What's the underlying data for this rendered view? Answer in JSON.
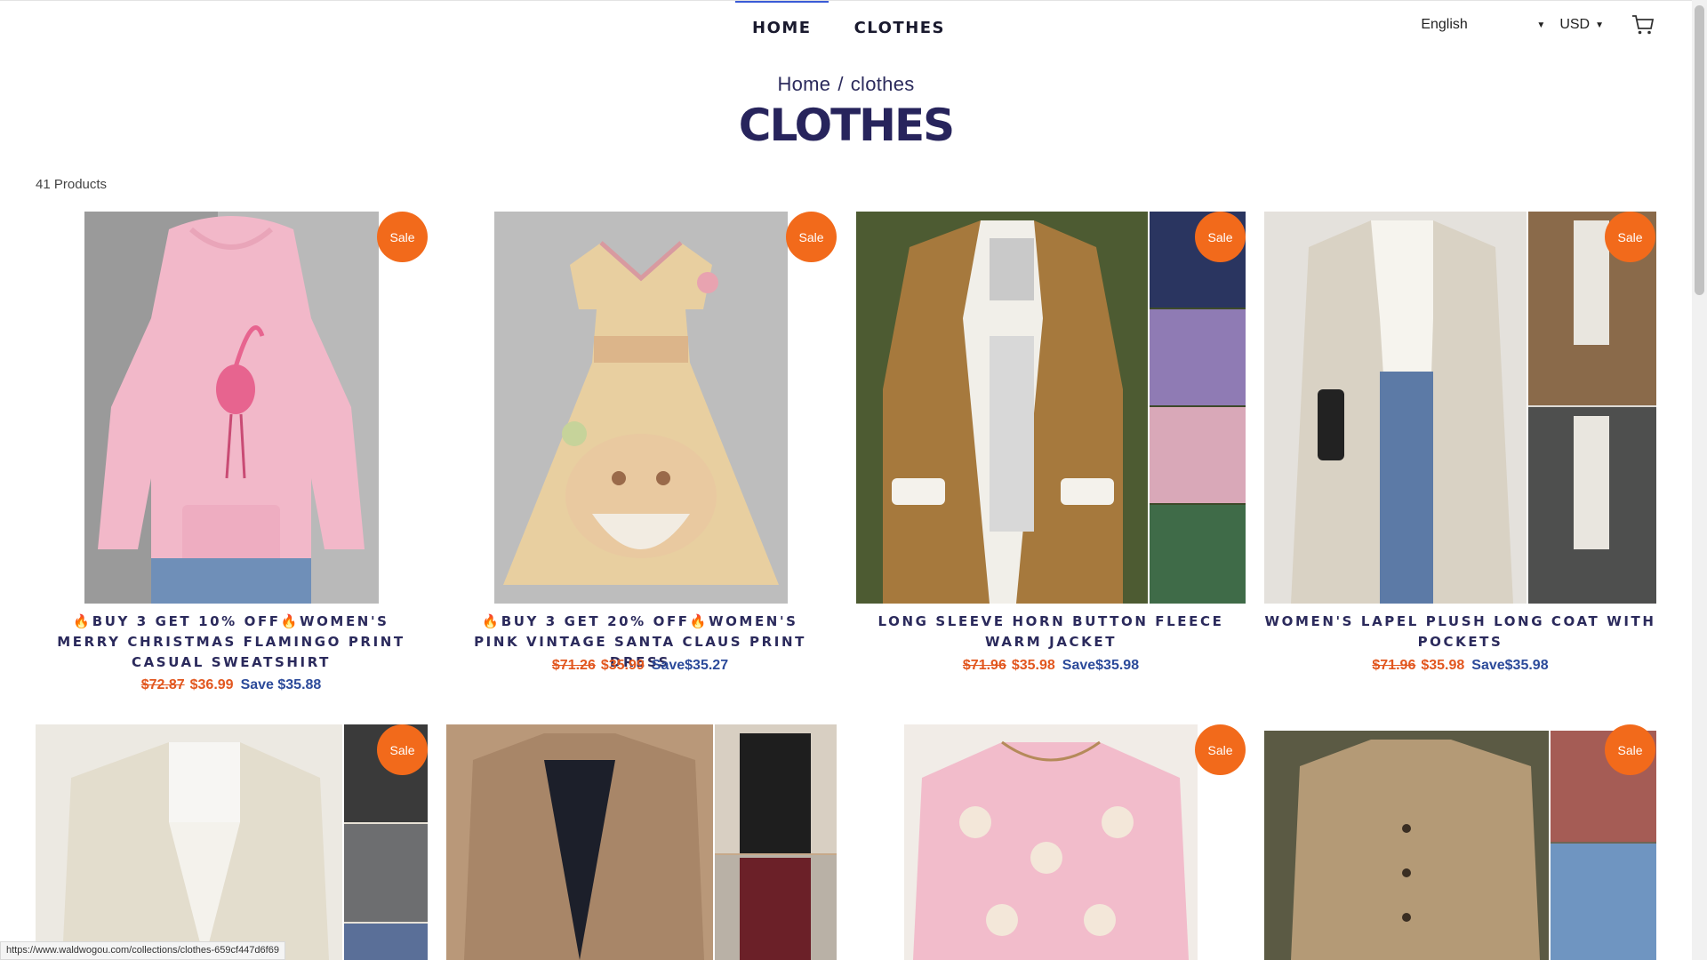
{
  "nav": {
    "items": [
      {
        "label": "HOME"
      },
      {
        "label": "CLOTHES"
      }
    ],
    "language": "English",
    "currency": "USD"
  },
  "breadcrumb": {
    "home": "Home",
    "separator": "/",
    "current": "clothes"
  },
  "page_title": "CLOTHES",
  "product_count": "41 Products",
  "sale_label": "Sale",
  "products": [
    {
      "title_prefix": "BUY 3 GET 10% OFF",
      "title": "WOMEN'S MERRY CHRISTMAS FLAMINGO PRINT CASUAL SWEATSHIRT",
      "price_old": "$72.87",
      "price": "$36.99",
      "save": "Save $35.88"
    },
    {
      "title_prefix": "BUY 3 GET 20% OFF",
      "title": "WOMEN'S PINK VINTAGE SANTA CLAUS PRINT DRESS",
      "price_old": "$71.26",
      "price": "$35.99",
      "save": "Save$35.27"
    },
    {
      "title": "LONG SLEEVE HORN BUTTON FLEECE WARM JACKET",
      "price_old": "$71.96",
      "price": "$35.98",
      "save": "Save$35.98"
    },
    {
      "title": "WOMEN'S LAPEL PLUSH LONG COAT WITH POCKETS",
      "price_old": "$71.96",
      "price": "$35.98",
      "save": "Save$35.98"
    }
  ],
  "status_url": "https://www.waldwogou.com/collections/clothes-659cf447d6f69",
  "colors": {
    "accent": "#f26a1b",
    "title": "#27245c",
    "price": "#e2571f",
    "save": "#2b4a9a"
  }
}
